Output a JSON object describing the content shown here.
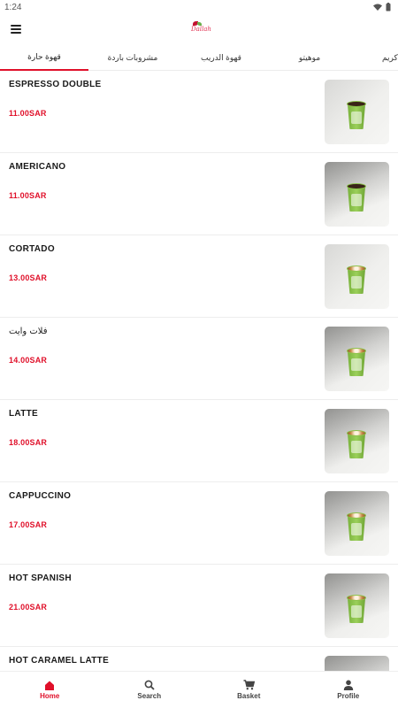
{
  "status": {
    "time": "1:24"
  },
  "app": {
    "logo_text": "Dallah"
  },
  "tabs": [
    {
      "label": "كريم"
    },
    {
      "label": "موهيتو"
    },
    {
      "label": "قهوة الدريب"
    },
    {
      "label": "مشروبات باردة"
    },
    {
      "label": "قهوة حارة",
      "active": true
    }
  ],
  "items": [
    {
      "name": "ESPRESSO DOUBLE",
      "price": "11.00SAR",
      "image": "espresso-cup-photo"
    },
    {
      "name": "AMERICANO",
      "price": "11.00SAR",
      "image": "americano-cup-photo"
    },
    {
      "name": "CORTADO",
      "price": "13.00SAR",
      "image": "cortado-cup-photo"
    },
    {
      "name": "فلات وايت",
      "price": "14.00SAR",
      "image": "flat-white-cup-photo"
    },
    {
      "name": "LATTE",
      "price": "18.00SAR",
      "image": "latte-cup-photo"
    },
    {
      "name": "CAPPUCCINO",
      "price": "17.00SAR",
      "image": "cappuccino-cup-photo"
    },
    {
      "name": "HOT SPANISH",
      "price": "21.00SAR",
      "image": "hot-spanish-cup-photo"
    },
    {
      "name": "HOT CARAMEL LATTE",
      "price": "",
      "image": "hot-caramel-latte-cup-photo"
    }
  ],
  "bottom_nav": [
    {
      "label": "Home",
      "icon": "home-icon",
      "active": true
    },
    {
      "label": "Search",
      "icon": "search-icon"
    },
    {
      "label": "Basket",
      "icon": "cart-icon"
    },
    {
      "label": "Profile",
      "icon": "person-icon"
    }
  ],
  "colors": {
    "accent": "#e0102a",
    "divider": "#ededed"
  }
}
